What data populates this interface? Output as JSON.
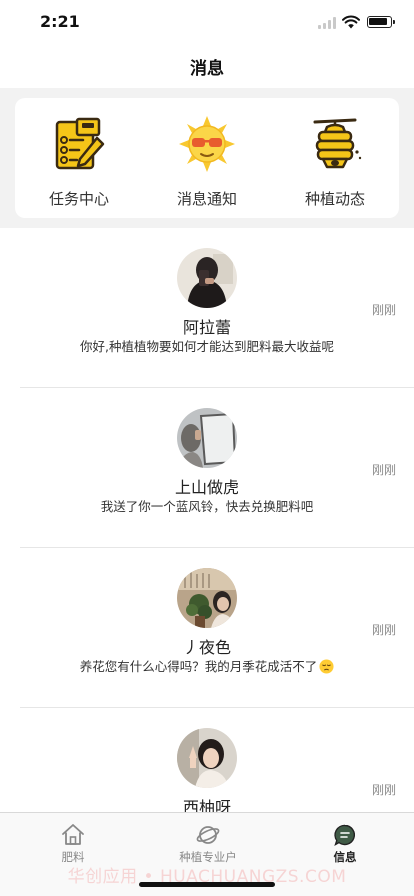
{
  "status_bar": {
    "time": "2:21"
  },
  "nav": {
    "title": "消息"
  },
  "shortcuts": [
    {
      "label": "任务中心",
      "icon": "task-clipboard-icon"
    },
    {
      "label": "消息通知",
      "icon": "sun-sunglasses-icon"
    },
    {
      "label": "种植动态",
      "icon": "beehive-icon"
    }
  ],
  "messages": [
    {
      "name": "阿拉蕾",
      "text": "你好,种植植物要如何才能达到肥料最大收益呢",
      "time": "刚刚"
    },
    {
      "name": "上山做虎",
      "text": "我送了你一个蓝风铃，快去兑换肥料吧",
      "time": "刚刚"
    },
    {
      "name": "丿夜色",
      "text": "养花您有什么心得吗？我的月季花成活不了",
      "emoji": "pensive-face-icon",
      "time": "刚刚"
    },
    {
      "name": "西柚呀",
      "text": "",
      "time": "刚刚"
    }
  ],
  "tabs": [
    {
      "label": "肥料",
      "icon": "house-icon",
      "active": false
    },
    {
      "label": "种植专业户",
      "icon": "planet-icon",
      "active": false
    },
    {
      "label": "信息",
      "icon": "chat-bubble-icon",
      "active": true
    }
  ],
  "watermark": "华创应用 • HUACHUANGZS.COM",
  "colors": {
    "accent_yellow": "#F5C518",
    "text_primary": "#222222",
    "text_secondary": "#888888",
    "panel_bg": "#F2F2F2"
  }
}
